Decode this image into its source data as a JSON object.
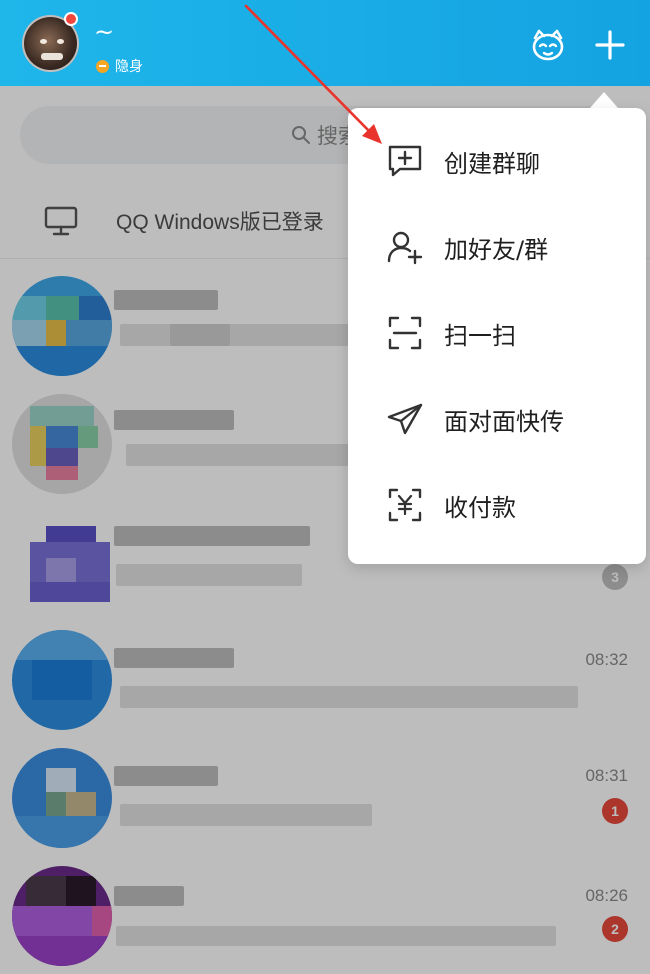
{
  "header": {
    "nickname": "~",
    "status": "隐身",
    "status_color": "#f5a623",
    "background": "#1aaee8",
    "icons": [
      "avatar-pet-icon",
      "plus-icon"
    ]
  },
  "search": {
    "placeholder": "搜索"
  },
  "pc_login": {
    "text": "QQ Windows版已登录",
    "icon": "monitor-icon"
  },
  "chats": [
    {
      "time": "",
      "badge": ""
    },
    {
      "time": "",
      "badge": ""
    },
    {
      "time": "",
      "badge": "3",
      "badge_color": "#bfbfbf"
    },
    {
      "time": "08:32",
      "badge": ""
    },
    {
      "time": "08:31",
      "badge": "1",
      "badge_color": "#e8493b"
    },
    {
      "time": "08:26",
      "badge": "2",
      "badge_color": "#e8493b"
    }
  ],
  "menu": {
    "items": [
      {
        "label": "创建群聊",
        "icon": "create-group-chat-icon"
      },
      {
        "label": "加好友/群",
        "icon": "add-friend-icon"
      },
      {
        "label": "扫一扫",
        "icon": "scan-icon"
      },
      {
        "label": "面对面快传",
        "icon": "paper-plane-icon"
      },
      {
        "label": "收付款",
        "icon": "yuan-payment-icon"
      }
    ]
  },
  "annotation": {
    "arrow_color": "#e8342c"
  }
}
